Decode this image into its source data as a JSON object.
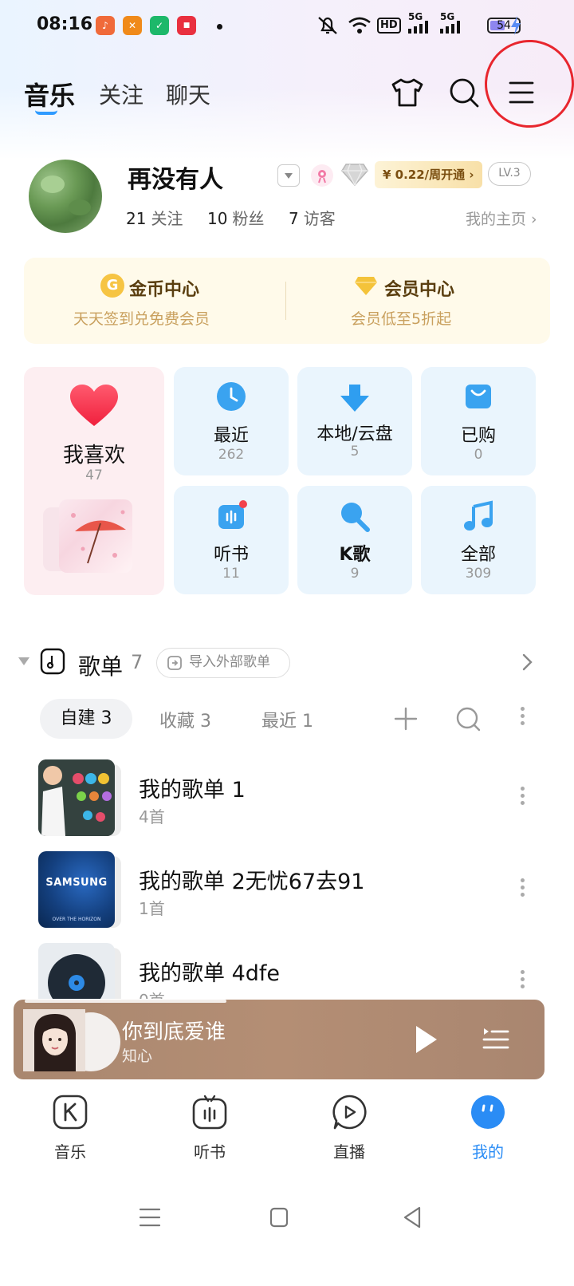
{
  "status_bar": {
    "time": "08:16",
    "network_labels": [
      "5G",
      "5G"
    ],
    "hd_label": "HD",
    "battery": "54",
    "battery_level": 0.54,
    "app_badges": [
      {
        "name": "music-app-badge",
        "color": "#f06a3a",
        "glyph": "♪"
      },
      {
        "name": "fitness-app-badge",
        "color": "#f08a1a",
        "glyph": "✕"
      },
      {
        "name": "green-app-badge",
        "color": "#1db86a",
        "glyph": "✓"
      },
      {
        "name": "red-app-badge",
        "color": "#e9303f",
        "glyph": "■"
      }
    ]
  },
  "header": {
    "tabs": [
      {
        "label": "音乐",
        "active": true
      },
      {
        "label": "关注",
        "active": false
      },
      {
        "label": "聊天",
        "active": false
      }
    ],
    "icons": [
      "tshirt-icon",
      "search-icon",
      "menu-icon"
    ]
  },
  "profile": {
    "username": "再没有人",
    "vip_promo": "¥ 0.22/周开通 ›",
    "level": "LV.3",
    "stats": [
      {
        "value": "21",
        "label": "关注"
      },
      {
        "value": "10",
        "label": "粉丝"
      },
      {
        "value": "7",
        "label": "访客"
      }
    ],
    "homepage_link": "我的主页 ›"
  },
  "centers": [
    {
      "title": "金币中心",
      "subtitle": "天天签到兑免费会员",
      "icon": "coin-icon",
      "glyph": "G"
    },
    {
      "title": "会员中心",
      "subtitle": "会员低至5折起",
      "icon": "diamond-icon"
    }
  ],
  "favorites": {
    "label": "我喜欢",
    "count": "47"
  },
  "tiles": [
    {
      "label": "最近",
      "count": "262",
      "icon": "clock-icon"
    },
    {
      "label": "本地/云盘",
      "count": "5",
      "icon": "download-icon"
    },
    {
      "label": "已购",
      "count": "0",
      "icon": "bag-icon"
    },
    {
      "label": "听书",
      "count": "11",
      "icon": "audiobook-icon"
    },
    {
      "label": "K歌",
      "count": "9",
      "icon": "microphone-icon"
    },
    {
      "label": "全部",
      "count": "309",
      "icon": "music-note-icon"
    }
  ],
  "playlists_section": {
    "title": "歌单",
    "count": "7",
    "import_label": "导入外部歌单",
    "tabs": [
      {
        "label": "自建 3",
        "active": true
      },
      {
        "label": "收藏 3",
        "active": false
      },
      {
        "label": "最近 1",
        "active": false
      }
    ],
    "items": [
      {
        "name": "我的歌单 1",
        "count": "4首"
      },
      {
        "name": "我的歌单 2无忧67去91",
        "count": "1首"
      },
      {
        "name": "我的歌单 4dfe",
        "count": "0首"
      }
    ],
    "cover_text": {
      "samsung": "SAMSUNG",
      "samsung_sub": "OVER THE HORIZON"
    }
  },
  "player": {
    "title": "你到底爱谁",
    "artist": "知心",
    "progress": 0.38
  },
  "bottom_nav": [
    {
      "label": "音乐",
      "icon": "music-k-icon",
      "active": false
    },
    {
      "label": "听书",
      "icon": "audiobook-nav-icon",
      "active": false
    },
    {
      "label": "直播",
      "icon": "live-icon",
      "active": false
    },
    {
      "label": "我的",
      "icon": "profile-nav-icon",
      "active": true
    }
  ]
}
